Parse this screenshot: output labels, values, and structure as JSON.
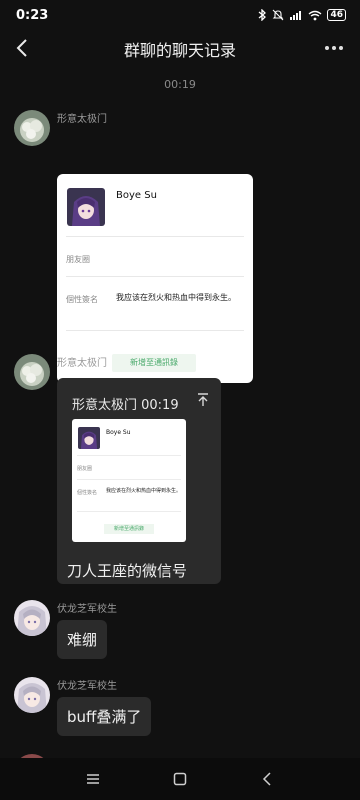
{
  "status": {
    "time": "0:23",
    "battery": "46"
  },
  "header": {
    "title": "群聊的聊天记录"
  },
  "chat": {
    "timestamp": "00:19",
    "messages": [
      {
        "sender": "形意太极门",
        "card": {
          "name": "Boye Su",
          "moments_label": "朋友圈",
          "signature_label": "個性簽名",
          "signature": "我应该在烈火和热血中得到永生。",
          "add_button": "新增至通訊錄"
        }
      },
      {
        "sender": "形意太极门",
        "forward": {
          "title": "形意太极门 00:19",
          "caption": "刀人王座的微信号",
          "card": {
            "name": "Boye Su",
            "moments_label": "朋友圈",
            "signature_label": "個性簽名",
            "signature": "我应该在烈火和热血中得到永生。",
            "add_button": "新增至通訊錄"
          }
        }
      },
      {
        "sender": "伏龙芝军校生",
        "text": "难绷"
      },
      {
        "sender": "伏龙芝军校生",
        "text": "buff叠满了"
      }
    ]
  },
  "colors": {
    "background": "#111111",
    "bubble": "#2b2b2b",
    "card": "#ffffff",
    "add_button_text": "#48a96a"
  }
}
